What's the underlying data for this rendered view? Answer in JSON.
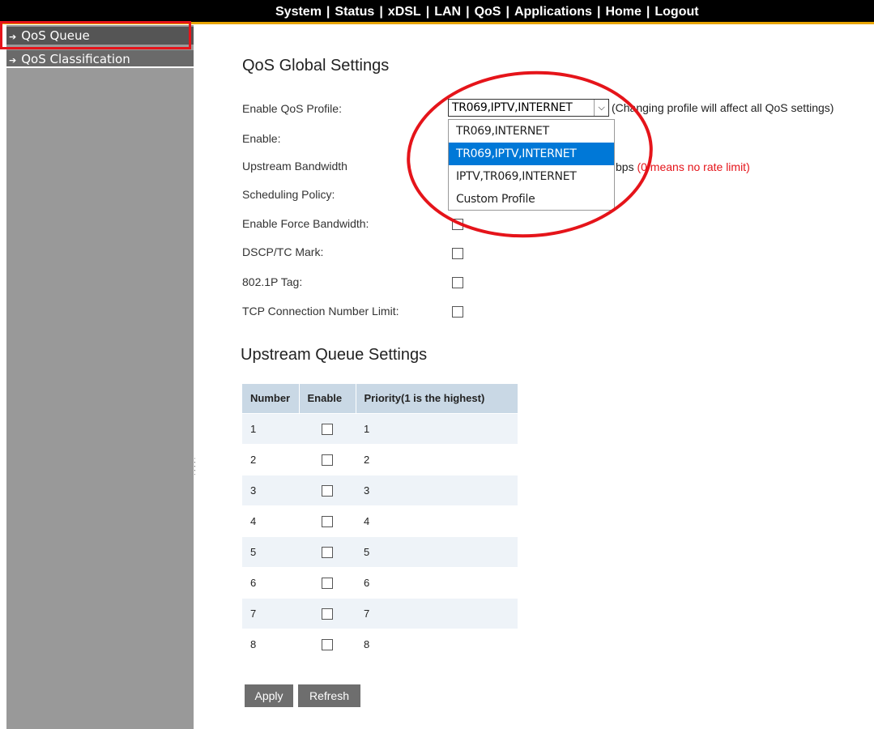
{
  "topnav": {
    "items": [
      "System",
      "Status",
      "xDSL",
      "LAN",
      "QoS",
      "Applications",
      "Home",
      "Logout"
    ],
    "separator": "|"
  },
  "sidebar": {
    "items": [
      {
        "label": "QoS Queue",
        "active": true
      },
      {
        "label": "QoS Classification",
        "active": false
      }
    ]
  },
  "global": {
    "title": "QoS Global Settings",
    "profile_label": "Enable QoS Profile:",
    "profile_value": "TR069,IPTV,INTERNET",
    "profile_note": "(Changing profile will affect all QoS settings)",
    "profile_options": [
      "TR069,INTERNET",
      "TR069,IPTV,INTERNET",
      "IPTV,TR069,INTERNET",
      "Custom Profile"
    ],
    "profile_selected_index": 1,
    "enable_label": "Enable:",
    "upstream_label": "Upstream Bandwidth",
    "upstream_unit": "bps",
    "upstream_note": "(0 means no rate limit)",
    "scheduling_label": "Scheduling Policy:",
    "force_bw_label": "Enable Force Bandwidth:",
    "dscp_label": "DSCP/TC Mark:",
    "tag_label": "802.1P Tag:",
    "tcp_label": "TCP Connection Number Limit:"
  },
  "queue": {
    "title": "Upstream Queue Settings",
    "columns": [
      "Number",
      "Enable",
      "Priority(1 is the highest)"
    ],
    "rows": [
      {
        "number": "1",
        "enabled": false,
        "priority": "1"
      },
      {
        "number": "2",
        "enabled": false,
        "priority": "2"
      },
      {
        "number": "3",
        "enabled": false,
        "priority": "3"
      },
      {
        "number": "4",
        "enabled": false,
        "priority": "4"
      },
      {
        "number": "5",
        "enabled": false,
        "priority": "5"
      },
      {
        "number": "6",
        "enabled": false,
        "priority": "6"
      },
      {
        "number": "7",
        "enabled": false,
        "priority": "7"
      },
      {
        "number": "8",
        "enabled": false,
        "priority": "8"
      }
    ]
  },
  "buttons": {
    "apply": "Apply",
    "refresh": "Refresh"
  },
  "colors": {
    "highlight": "#e5141a",
    "dropdown_selected": "#0078d7",
    "table_header": "#c9d8e5",
    "sidebar": "#999999"
  }
}
